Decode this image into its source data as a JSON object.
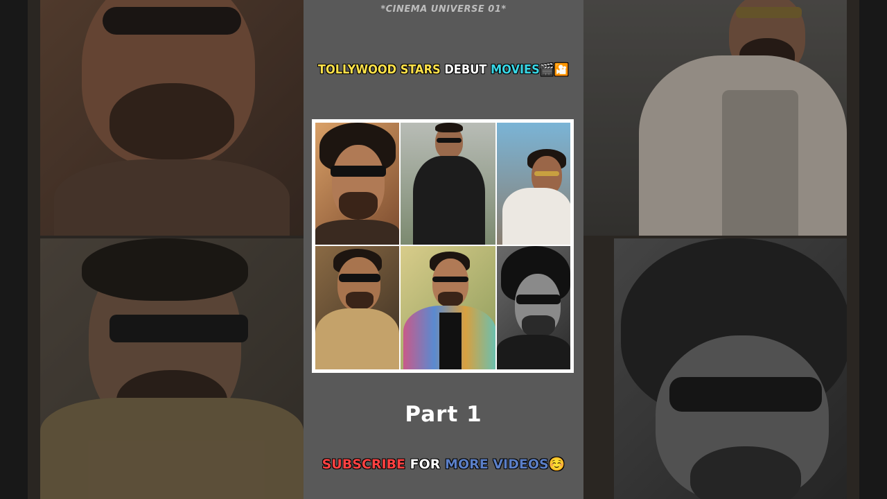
{
  "channel_name": "*CINEMA UNIVERSE 01*",
  "headline": {
    "word1": "TOLLYWOOD STARS",
    "word2": "DEBUT",
    "word3": "MOVIES",
    "emoji": "🎬🎦"
  },
  "grid_images": [
    "actor-1-sunglasses",
    "actor-2-black-shirt",
    "actor-3-white-blazer",
    "actor-4-police-uniform",
    "actor-5-printed-shirt",
    "actor-6-monochrome-sunglasses"
  ],
  "part_label": "Part 1",
  "subscribe": {
    "word1": "SUBSCRIBE",
    "word2": "FOR",
    "word3": "MORE VIDEOS",
    "emoji": "☺️"
  },
  "colors": {
    "headline_yellow": "#ffe24a",
    "headline_cyan": "#39d7e6",
    "subscribe_red": "#ff4242",
    "subscribe_blue": "#5b7fc7",
    "center_panel": "#595959"
  }
}
